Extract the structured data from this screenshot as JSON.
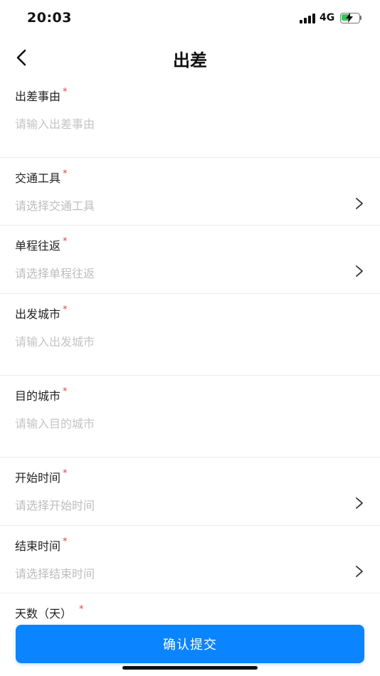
{
  "status_bar": {
    "time": "20:03",
    "network": "4G",
    "battery_color": "#35c759",
    "battery_fraction": 0.55
  },
  "nav": {
    "title": "出差"
  },
  "required_mark": "*",
  "fields": [
    {
      "label": "出差事由",
      "placeholder": "请输入出差事由",
      "kind": "input"
    },
    {
      "label": "交通工具",
      "placeholder": "请选择交通工具",
      "kind": "select"
    },
    {
      "label": "单程往返",
      "placeholder": "请选择单程往返",
      "kind": "select"
    },
    {
      "label": "出发城市",
      "placeholder": "请输入出发城市",
      "kind": "input"
    },
    {
      "label": "目的城市",
      "placeholder": "请输入目的城市",
      "kind": "input"
    },
    {
      "label": "开始时间",
      "placeholder": "请选择开始时间",
      "kind": "select"
    },
    {
      "label": "结束时间",
      "placeholder": "请选择结束时间",
      "kind": "select"
    },
    {
      "label": "天数（天）",
      "placeholder": "",
      "kind": "input"
    }
  ],
  "submit": {
    "label": "确认提交",
    "color": "#0a84ff"
  }
}
